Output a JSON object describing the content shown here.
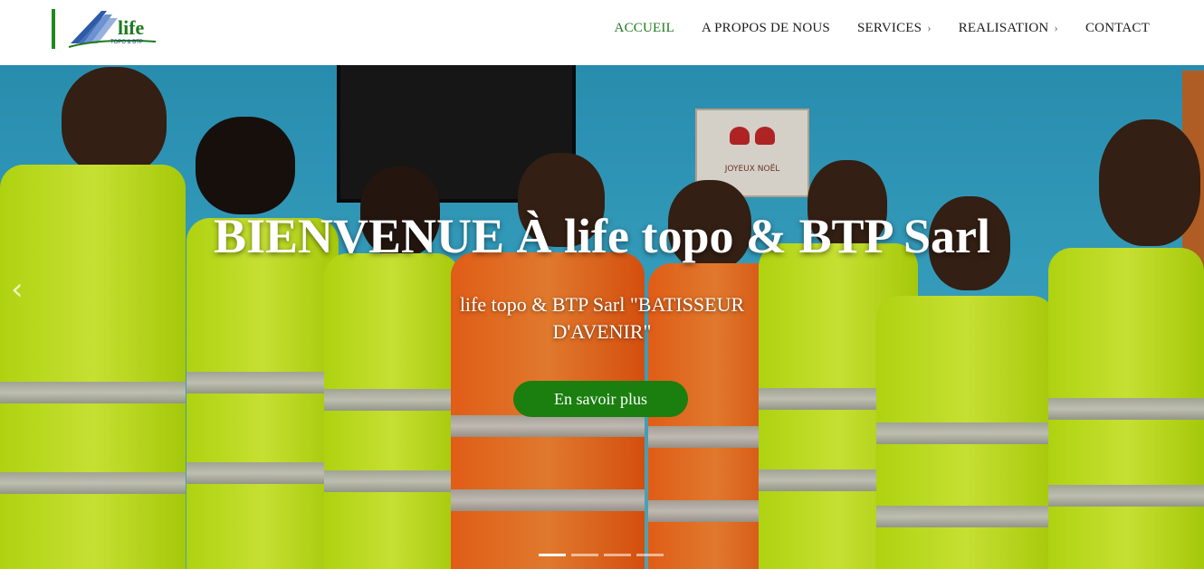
{
  "header": {
    "logo_text": "life",
    "logo_sub": "TOPO & BTP",
    "nav": [
      {
        "label": "ACCUEIL",
        "active": true,
        "dropdown": false
      },
      {
        "label": "A PROPOS DE NOUS",
        "active": false,
        "dropdown": false
      },
      {
        "label": "SERVICES",
        "active": false,
        "dropdown": true
      },
      {
        "label": "REALISATION",
        "active": false,
        "dropdown": true
      },
      {
        "label": "CONTACT",
        "active": false,
        "dropdown": false
      }
    ],
    "dropdown_glyph": "›"
  },
  "hero": {
    "title": "BIENVENUE À life topo & BTP Sarl",
    "subtitle": "life topo & BTP Sarl \"BATISSEUR D'AVENIR\"",
    "cta_label": "En savoir plus",
    "prev_arrow": "‹",
    "slides_count": 4,
    "active_slide": 1,
    "card_text": "JOYEUX NOËL"
  },
  "colors": {
    "brand_green": "#1e7a1e",
    "cta_green": "#1a7f0e",
    "vest_yellow": "#d8f520",
    "vest_orange": "#ff6a1a"
  }
}
